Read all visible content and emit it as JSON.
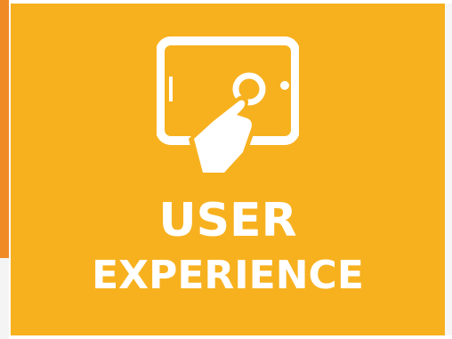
{
  "colors": {
    "tile_background": "#f7b11f",
    "neighbor_tile": "#f08a24",
    "text": "#ffffff"
  },
  "icon": {
    "name": "tablet-touch-icon"
  },
  "title": {
    "line1": "USER",
    "line2": "EXPERIENCE"
  }
}
